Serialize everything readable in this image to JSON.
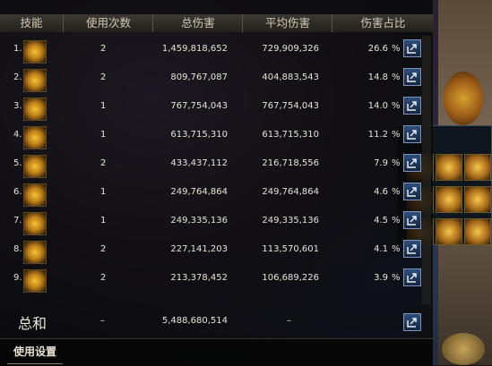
{
  "header": {
    "columns": [
      "技能",
      "使用次数",
      "总伤害",
      "平均伤害",
      "伤害占比"
    ]
  },
  "rows": [
    {
      "no": "1.",
      "uses": "2",
      "total": "1,459,818,652",
      "avg": "729,909,326",
      "pct": "26.6",
      "sym": "%"
    },
    {
      "no": "2.",
      "uses": "2",
      "total": "809,767,087",
      "avg": "404,883,543",
      "pct": "14.8",
      "sym": "%"
    },
    {
      "no": "3.",
      "uses": "1",
      "total": "767,754,043",
      "avg": "767,754,043",
      "pct": "14.0",
      "sym": "%"
    },
    {
      "no": "4.",
      "uses": "1",
      "total": "613,715,310",
      "avg": "613,715,310",
      "pct": "11.2",
      "sym": "%"
    },
    {
      "no": "5.",
      "uses": "2",
      "total": "433,437,112",
      "avg": "216,718,556",
      "pct": "7.9",
      "sym": "%"
    },
    {
      "no": "6.",
      "uses": "1",
      "total": "249,764,864",
      "avg": "249,764,864",
      "pct": "4.6",
      "sym": "%"
    },
    {
      "no": "7.",
      "uses": "1",
      "total": "249,335,136",
      "avg": "249,335,136",
      "pct": "4.5",
      "sym": "%"
    },
    {
      "no": "8.",
      "uses": "2",
      "total": "227,141,203",
      "avg": "113,570,601",
      "pct": "4.1",
      "sym": "%"
    },
    {
      "no": "9.",
      "uses": "2",
      "total": "213,378,452",
      "avg": "106,689,226",
      "pct": "3.9",
      "sym": "%"
    }
  ],
  "total": {
    "label": "总和",
    "uses": "–",
    "total": "5,488,680,514",
    "avg": "–"
  },
  "footer": {
    "tab": "使用设置"
  },
  "icons": {
    "share": "share-icon",
    "skill": "skill-icon"
  },
  "colors": {
    "accent": "#d6a22d",
    "share_button": "#2d4d7a"
  }
}
